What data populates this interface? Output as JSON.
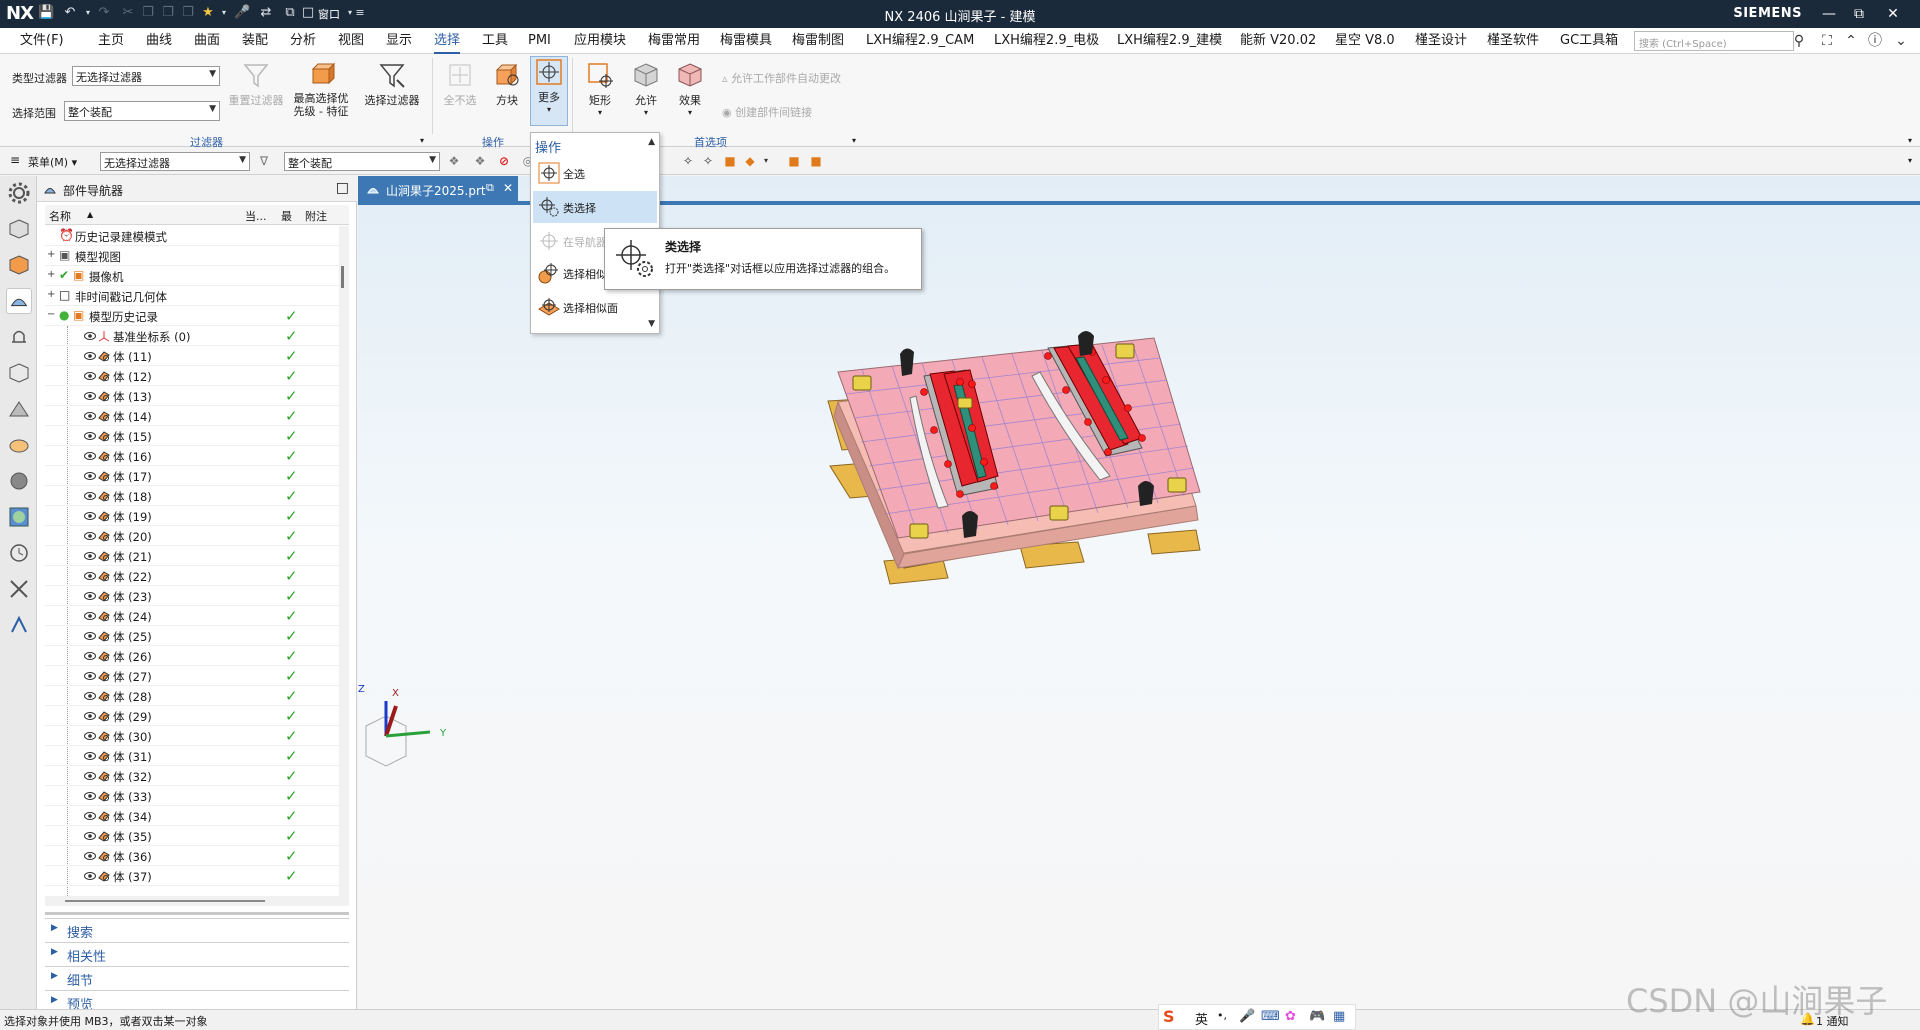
{
  "titlebar": {
    "logo": "NX",
    "title": "NX 2406 山涧果子 - 建模",
    "window_menu": "窗口",
    "brand": "SIEMENS"
  },
  "menu": {
    "file": "文件(F)",
    "tabs": [
      "主页",
      "曲线",
      "曲面",
      "装配",
      "分析",
      "视图",
      "显示",
      "选择",
      "工具",
      "PMI",
      "应用模块",
      "梅雷常用",
      "梅雷模具",
      "梅雷制图",
      "LXH编程2.9_CAM",
      "LXH编程2.9_电极",
      "LXH编程2.9_建模",
      "能新 V20.02",
      "星空 V8.0",
      "槿圣设计",
      "槿圣软件",
      "GC工具箱"
    ],
    "active_tab": "选择",
    "search_placeholder": "搜索 (Ctrl+Space)"
  },
  "ribbon": {
    "type_filter_label": "类型过滤器",
    "type_filter_value": "无选择过滤器",
    "scope_label": "选择范围",
    "scope_value": "整个装配",
    "reset_filter": "重置过滤器",
    "highest_priority": "最高选择优先级 - 特征",
    "select_filter": "选择过滤器",
    "filter_group": "过滤器",
    "deselect_all": "全不选",
    "box": "方块",
    "more": "更多",
    "rect": "矩形",
    "allow": "允许",
    "effect": "效果",
    "ops_group": "操作",
    "prefs_group": "首选项",
    "allow_workpart": "允许工作部件自动更改",
    "create_link": "创建部件间链接"
  },
  "selbar": {
    "menu": "菜单(M)",
    "filter": "无选择过滤器",
    "scope": "整个装配"
  },
  "navigator": {
    "title": "部件导航器",
    "columns": [
      "名称",
      "当...",
      "最",
      "附注"
    ],
    "rows": [
      {
        "label": "历史记录建模模式",
        "exp": "",
        "indent": 0,
        "check": false
      },
      {
        "label": "模型视图",
        "exp": "+",
        "indent": 0,
        "check": false
      },
      {
        "label": "摄像机",
        "exp": "+",
        "indent": 0,
        "check": false
      },
      {
        "label": "非时间戳记几何体",
        "exp": "+",
        "indent": 0,
        "check": false
      },
      {
        "label": "模型历史记录",
        "exp": "-",
        "indent": 0,
        "check": true
      },
      {
        "label": "基准坐标系 (0)",
        "exp": "",
        "indent": 1,
        "check": true
      },
      {
        "label": "体 (11)",
        "exp": "",
        "indent": 1,
        "check": true
      },
      {
        "label": "体 (12)",
        "exp": "",
        "indent": 1,
        "check": true
      },
      {
        "label": "体 (13)",
        "exp": "",
        "indent": 1,
        "check": true
      },
      {
        "label": "体 (14)",
        "exp": "",
        "indent": 1,
        "check": true
      },
      {
        "label": "体 (15)",
        "exp": "",
        "indent": 1,
        "check": true
      },
      {
        "label": "体 (16)",
        "exp": "",
        "indent": 1,
        "check": true
      },
      {
        "label": "体 (17)",
        "exp": "",
        "indent": 1,
        "check": true
      },
      {
        "label": "体 (18)",
        "exp": "",
        "indent": 1,
        "check": true
      },
      {
        "label": "体 (19)",
        "exp": "",
        "indent": 1,
        "check": true
      },
      {
        "label": "体 (20)",
        "exp": "",
        "indent": 1,
        "check": true
      },
      {
        "label": "体 (21)",
        "exp": "",
        "indent": 1,
        "check": true
      },
      {
        "label": "体 (22)",
        "exp": "",
        "indent": 1,
        "check": true
      },
      {
        "label": "体 (23)",
        "exp": "",
        "indent": 1,
        "check": true
      },
      {
        "label": "体 (24)",
        "exp": "",
        "indent": 1,
        "check": true
      },
      {
        "label": "体 (25)",
        "exp": "",
        "indent": 1,
        "check": true
      },
      {
        "label": "体 (26)",
        "exp": "",
        "indent": 1,
        "check": true
      },
      {
        "label": "体 (27)",
        "exp": "",
        "indent": 1,
        "check": true
      },
      {
        "label": "体 (28)",
        "exp": "",
        "indent": 1,
        "check": true
      },
      {
        "label": "体 (29)",
        "exp": "",
        "indent": 1,
        "check": true
      },
      {
        "label": "体 (30)",
        "exp": "",
        "indent": 1,
        "check": true
      },
      {
        "label": "体 (31)",
        "exp": "",
        "indent": 1,
        "check": true
      },
      {
        "label": "体 (32)",
        "exp": "",
        "indent": 1,
        "check": true
      },
      {
        "label": "体 (33)",
        "exp": "",
        "indent": 1,
        "check": true
      },
      {
        "label": "体 (34)",
        "exp": "",
        "indent": 1,
        "check": true
      },
      {
        "label": "体 (35)",
        "exp": "",
        "indent": 1,
        "check": true
      },
      {
        "label": "体 (36)",
        "exp": "",
        "indent": 1,
        "check": true
      },
      {
        "label": "体 (37)",
        "exp": "",
        "indent": 1,
        "check": true
      }
    ],
    "sections": [
      "搜索",
      "相关性",
      "细节",
      "预览"
    ]
  },
  "document": {
    "tab": "山涧果子2025.prt"
  },
  "dropdown": {
    "header": "操作",
    "items": [
      "全选",
      "类选择",
      "在导航器",
      "选择相似",
      "选择相似面"
    ],
    "highlighted": "类选择"
  },
  "tooltip": {
    "title": "类选择",
    "desc": "打开\"类选择\"对话框以应用选择过滤器的组合。"
  },
  "triad": {
    "x": "X",
    "y": "Y",
    "z": "Z"
  },
  "status": {
    "message": "选择对象并使用 MB3，或者双击某一对象",
    "notice": "1 通知"
  },
  "ime": {
    "mode": "英"
  },
  "watermark": "CSDN @山涧果子",
  "colors": {
    "titlebar": "#1b2a3a",
    "accent": "#2d5fa6",
    "check": "#2fa52a",
    "plate": "#f3a9b6",
    "block": "#e8262f",
    "base": "#e8b84a"
  }
}
